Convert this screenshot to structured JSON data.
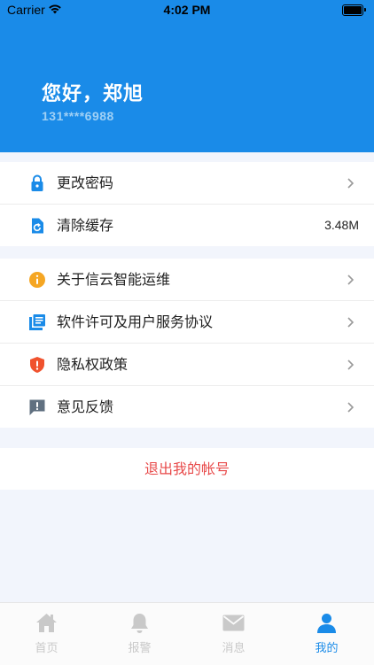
{
  "status_bar": {
    "carrier": "Carrier",
    "time": "4:02 PM"
  },
  "profile": {
    "greeting": "您好，郑旭",
    "phone": "131****6988"
  },
  "settings": [
    {
      "label": "更改密码",
      "icon": "lock-icon"
    },
    {
      "label": "清除缓存",
      "icon": "clear-cache-icon",
      "value": "3.48M"
    }
  ],
  "about": [
    {
      "label": "关于信云智能运维",
      "icon": "info-icon"
    },
    {
      "label": "软件许可及用户服务协议",
      "icon": "document-icon"
    },
    {
      "label": "隐私权政策",
      "icon": "shield-icon"
    },
    {
      "label": "意见反馈",
      "icon": "feedback-icon"
    }
  ],
  "logout": {
    "label": "退出我的帐号"
  },
  "tabbar": {
    "tabs": [
      {
        "label": "首页",
        "icon": "home-icon"
      },
      {
        "label": "报警",
        "icon": "bell-icon"
      },
      {
        "label": "消息",
        "icon": "mail-icon"
      },
      {
        "label": "我的",
        "icon": "user-icon",
        "active": true
      }
    ]
  },
  "colors": {
    "primary": "#1a8be8",
    "logout_red": "#e84a4a",
    "info_orange": "#f5a623",
    "privacy_red": "#f0522e"
  }
}
